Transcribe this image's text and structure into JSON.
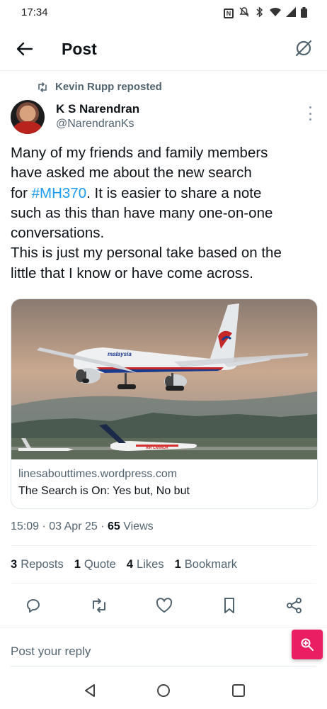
{
  "status_bar": {
    "time": "17:34"
  },
  "header": {
    "title": "Post"
  },
  "repost": {
    "label": "Kevin Rupp reposted"
  },
  "author": {
    "name": "K S Narendran",
    "handle": "@NarendranKs"
  },
  "post": {
    "line1": "Many of my friends and family members",
    "line2": "have asked me about the new search",
    "line3_prefix": "for ",
    "hashtag": "#MH370",
    "line3_suffix": ". It is easier to share a note",
    "line4": "such as this than have many one-on-one",
    "line5": "conversations.",
    "line6": "This is just my personal take based on the",
    "line7": "little that I know or have come across."
  },
  "card": {
    "domain": "linesabouttimes.wordpress.com",
    "title": "The Search is On: Yes but, No but",
    "image_lettering": {
      "plane_livery": "malaysia",
      "second_plane": "AIR CANADA"
    }
  },
  "meta": {
    "time": "15:09",
    "date": "03 Apr 25",
    "views_count": "65",
    "views_label": "Views"
  },
  "stats": {
    "reposts_count": "3",
    "reposts_label": "Reposts",
    "quote_count": "1",
    "quote_label": "Quote",
    "likes_count": "4",
    "likes_label": "Likes",
    "bookmark_count": "1",
    "bookmark_label": "Bookmark"
  },
  "reply": {
    "placeholder": "Post your reply"
  },
  "icons": {
    "back": "arrow-left-icon",
    "grok": "grok-icon",
    "repost": "repost-icon",
    "more": "more-vertical-icon",
    "reply": "reply-icon",
    "retweet": "retweet-icon",
    "like": "heart-icon",
    "bookmark": "bookmark-icon",
    "share": "share-icon",
    "zoom": "zoom-in-icon"
  },
  "colors": {
    "accent": "#1d9bf0",
    "zoom_button": "#e91e63",
    "secondary_text": "#536471"
  }
}
